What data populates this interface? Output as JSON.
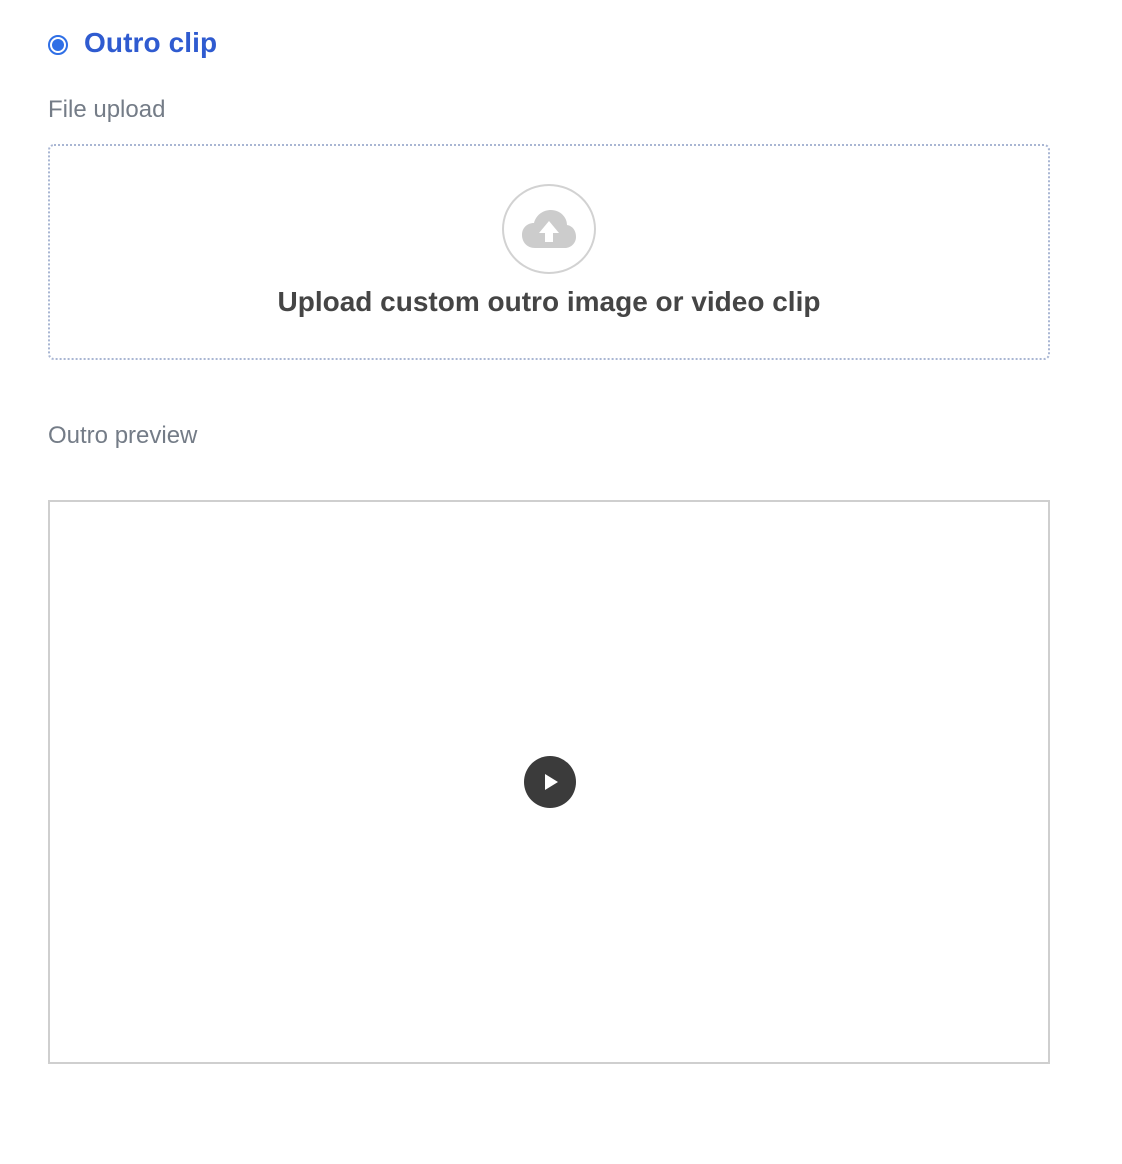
{
  "outro_option": {
    "label": "Outro clip",
    "selected": true,
    "accent_color": "#2f6fe6"
  },
  "file_upload": {
    "label": "File upload",
    "prompt": "Upload custom outro image or video clip",
    "icon": "cloud-upload-icon"
  },
  "preview": {
    "label": "Outro preview",
    "icon": "play-icon"
  }
}
